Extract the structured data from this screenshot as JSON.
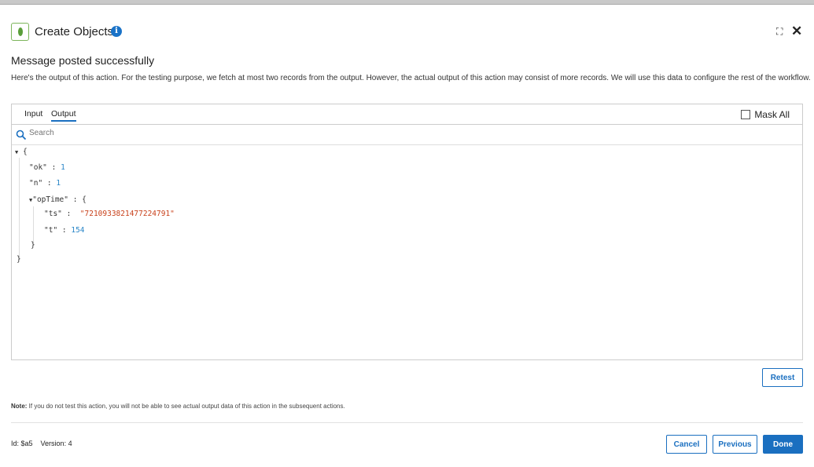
{
  "header": {
    "title": "Create Objects",
    "info_icon": "i"
  },
  "heading": "Message posted successfully",
  "description": "Here's the output of this action. For the testing purpose, we fetch at most two records from the output. However, the actual output of this action may consist of more records. We will use this data to configure the rest of the workflow.",
  "panel": {
    "tabs": [
      "Input",
      "Output"
    ],
    "active_tab": "Output",
    "mask_all_label": "Mask All",
    "search_placeholder": "Search"
  },
  "json": {
    "open": "{",
    "ok_key": "\"ok\"",
    "ok_val": "1",
    "n_key": "\"n\"",
    "n_val": "1",
    "optime_key": "\"opTime\"",
    "optime_open": "{",
    "ts_key": "\"ts\"",
    "ts_val": "\"7210933821477224791\"",
    "t_key": "\"t\"",
    "t_val": "154",
    "inner_close": "}",
    "close": "}",
    "sep": " : "
  },
  "retest_label": "Retest",
  "note": {
    "label": "Note:",
    "text": " If you do not test this action, you will not be able to see actual output data of this action in the subsequent actions."
  },
  "footer": {
    "id": "Id: $a5",
    "version": "Version: 4",
    "cancel": "Cancel",
    "previous": "Previous",
    "done": "Done"
  }
}
